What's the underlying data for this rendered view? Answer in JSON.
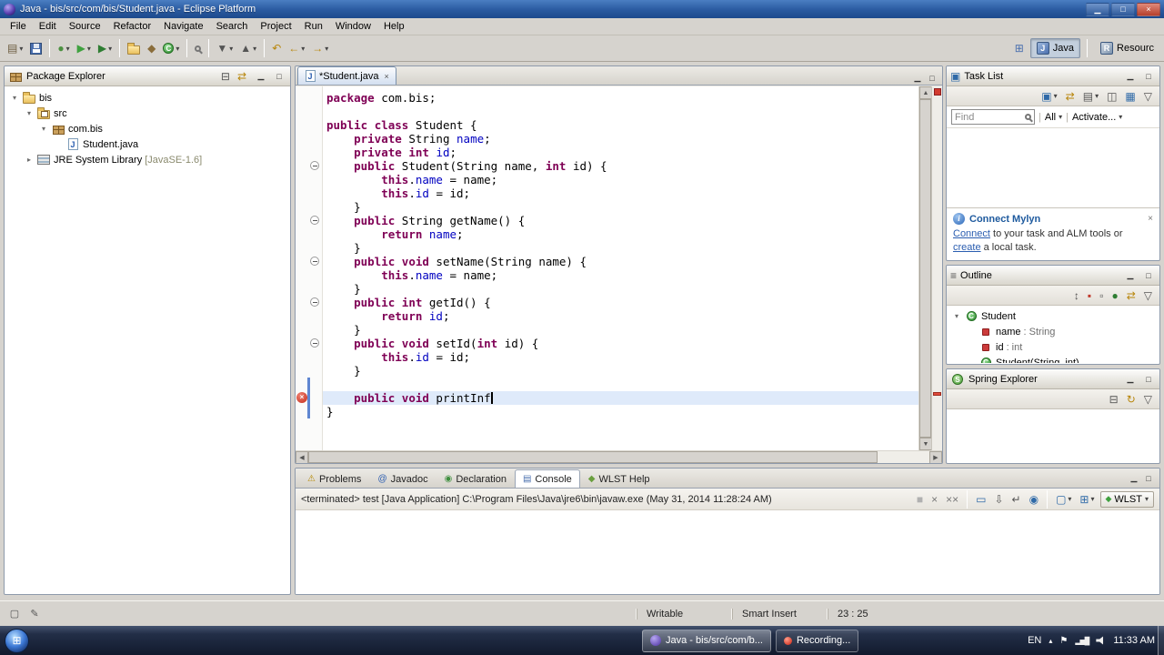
{
  "window": {
    "title": "Java - bis/src/com/bis/Student.java - Eclipse Platform"
  },
  "icons": {
    "minimize": "▁",
    "maximize": "□",
    "close": "×",
    "dropdown": "▾",
    "collapsed": "▸",
    "expanded": "▾",
    "up_scroll": "▲",
    "down_scroll": "▼",
    "left_scroll": "◀",
    "right_scroll": "▶",
    "start_orb": "⊞",
    "tray_arrow": "▴",
    "tray_flag": "⚑",
    "tray_net": "▂▅█",
    "find_magnifier": "magnifier"
  },
  "menubar": {
    "items": [
      "File",
      "Edit",
      "Source",
      "Refactor",
      "Navigate",
      "Search",
      "Project",
      "Run",
      "Window",
      "Help"
    ]
  },
  "toolbar": {
    "buttons": [
      {
        "name": "new-wizard-button",
        "glyph": "▤",
        "color": "#6b5b3e",
        "dropdown": true
      },
      {
        "name": "save-button",
        "css": "floppy"
      },
      {
        "sep": true
      },
      {
        "name": "debug-button",
        "glyph": "●",
        "color": "#4c9141",
        "dropdown": true
      },
      {
        "name": "run-button",
        "glyph": "▶",
        "color": "#3fa13f",
        "dropdown": true
      },
      {
        "name": "external-tools-run-button",
        "glyph": "▶",
        "color": "#2e7d32",
        "dropdown": true
      },
      {
        "sep": true
      },
      {
        "name": "new-java-project-button",
        "css": "folder"
      },
      {
        "name": "new-java-package-button",
        "glyph": "◆",
        "color": "#8a6d3b"
      },
      {
        "name": "new-java-class-button",
        "css": "class",
        "dropdown": true
      },
      {
        "sep": true
      },
      {
        "name": "search-button",
        "css": "magnifier"
      },
      {
        "sep": true
      },
      {
        "name": "next-annotation-button",
        "glyph": "▼",
        "color": "#555",
        "dropdown": true
      },
      {
        "name": "previous-annotation-button",
        "glyph": "▲",
        "color": "#555",
        "dropdown": true
      },
      {
        "sep": true
      },
      {
        "name": "last-edit-location-button",
        "glyph": "↶",
        "color": "#b8860b"
      },
      {
        "name": "back-button",
        "glyph": "←",
        "color": "#b8860b",
        "dropdown": true
      },
      {
        "name": "forward-button",
        "glyph": "→",
        "color": "#b8860b",
        "dropdown": true
      }
    ],
    "perspectives": {
      "active": "Java",
      "secondary": "Resourc"
    }
  },
  "package_explorer": {
    "title": "Package Explorer",
    "header_icons": [
      {
        "name": "collapse-all-button",
        "glyph": "⊟",
        "color": "#555"
      },
      {
        "name": "link-with-editor-button",
        "glyph": "⇄",
        "color": "#b8860b"
      }
    ],
    "tree": [
      {
        "label": "bis",
        "level": 0,
        "arrow": "expanded",
        "icon": "folder"
      },
      {
        "label": "src",
        "level": 1,
        "arrow": "expanded",
        "icon": "src"
      },
      {
        "label": "com.bis",
        "level": 2,
        "arrow": "expanded",
        "icon": "package"
      },
      {
        "label": "Student.java",
        "level": 3,
        "arrow": "none",
        "icon": "jfile"
      },
      {
        "label": "JRE System Library",
        "suffix": " [JavaSE-1.6]",
        "level": 1,
        "arrow": "collapsed",
        "icon": "lib"
      }
    ]
  },
  "editor": {
    "tab_label": "*Student.java",
    "cursor_line": 23,
    "error_line": 23,
    "fold_lines": [
      6,
      10,
      13,
      16,
      19
    ],
    "diff_lines": [
      22,
      23,
      24
    ],
    "overview_marks": [
      0.84
    ],
    "code": [
      [
        {
          "t": "k",
          "s": "package"
        },
        {
          "t": "p",
          "s": " com.bis;"
        }
      ],
      [],
      [
        {
          "t": "k",
          "s": "public"
        },
        {
          "t": "p",
          "s": " "
        },
        {
          "t": "k",
          "s": "class"
        },
        {
          "t": "p",
          "s": " Student {"
        }
      ],
      [
        {
          "t": "p",
          "s": "    "
        },
        {
          "t": "k",
          "s": "private"
        },
        {
          "t": "p",
          "s": " String "
        },
        {
          "t": "f",
          "s": "name"
        },
        {
          "t": "p",
          "s": ";"
        }
      ],
      [
        {
          "t": "p",
          "s": "    "
        },
        {
          "t": "k",
          "s": "private"
        },
        {
          "t": "p",
          "s": " "
        },
        {
          "t": "k",
          "s": "int"
        },
        {
          "t": "p",
          "s": " "
        },
        {
          "t": "f",
          "s": "id"
        },
        {
          "t": "p",
          "s": ";"
        }
      ],
      [
        {
          "t": "p",
          "s": "    "
        },
        {
          "t": "k",
          "s": "public"
        },
        {
          "t": "p",
          "s": " Student(String name, "
        },
        {
          "t": "k",
          "s": "int"
        },
        {
          "t": "p",
          "s": " id) {"
        }
      ],
      [
        {
          "t": "p",
          "s": "        "
        },
        {
          "t": "k",
          "s": "this"
        },
        {
          "t": "p",
          "s": "."
        },
        {
          "t": "f",
          "s": "name"
        },
        {
          "t": "p",
          "s": " = name;"
        }
      ],
      [
        {
          "t": "p",
          "s": "        "
        },
        {
          "t": "k",
          "s": "this"
        },
        {
          "t": "p",
          "s": "."
        },
        {
          "t": "f",
          "s": "id"
        },
        {
          "t": "p",
          "s": " = id;"
        }
      ],
      [
        {
          "t": "p",
          "s": "    }"
        }
      ],
      [
        {
          "t": "p",
          "s": "    "
        },
        {
          "t": "k",
          "s": "public"
        },
        {
          "t": "p",
          "s": " String getName() {"
        }
      ],
      [
        {
          "t": "p",
          "s": "        "
        },
        {
          "t": "k",
          "s": "return"
        },
        {
          "t": "p",
          "s": " "
        },
        {
          "t": "f",
          "s": "name"
        },
        {
          "t": "p",
          "s": ";"
        }
      ],
      [
        {
          "t": "p",
          "s": "    }"
        }
      ],
      [
        {
          "t": "p",
          "s": "    "
        },
        {
          "t": "k",
          "s": "public"
        },
        {
          "t": "p",
          "s": " "
        },
        {
          "t": "k",
          "s": "void"
        },
        {
          "t": "p",
          "s": " setName(String name) {"
        }
      ],
      [
        {
          "t": "p",
          "s": "        "
        },
        {
          "t": "k",
          "s": "this"
        },
        {
          "t": "p",
          "s": "."
        },
        {
          "t": "f",
          "s": "name"
        },
        {
          "t": "p",
          "s": " = name;"
        }
      ],
      [
        {
          "t": "p",
          "s": "    }"
        }
      ],
      [
        {
          "t": "p",
          "s": "    "
        },
        {
          "t": "k",
          "s": "public"
        },
        {
          "t": "p",
          "s": " "
        },
        {
          "t": "k",
          "s": "int"
        },
        {
          "t": "p",
          "s": " getId() {"
        }
      ],
      [
        {
          "t": "p",
          "s": "        "
        },
        {
          "t": "k",
          "s": "return"
        },
        {
          "t": "p",
          "s": " "
        },
        {
          "t": "f",
          "s": "id"
        },
        {
          "t": "p",
          "s": ";"
        }
      ],
      [
        {
          "t": "p",
          "s": "    }"
        }
      ],
      [
        {
          "t": "p",
          "s": "    "
        },
        {
          "t": "k",
          "s": "public"
        },
        {
          "t": "p",
          "s": " "
        },
        {
          "t": "k",
          "s": "void"
        },
        {
          "t": "p",
          "s": " setId("
        },
        {
          "t": "k",
          "s": "int"
        },
        {
          "t": "p",
          "s": " id) {"
        }
      ],
      [
        {
          "t": "p",
          "s": "        "
        },
        {
          "t": "k",
          "s": "this"
        },
        {
          "t": "p",
          "s": "."
        },
        {
          "t": "f",
          "s": "id"
        },
        {
          "t": "p",
          "s": " = id;"
        }
      ],
      [
        {
          "t": "p",
          "s": "    }"
        }
      ],
      [],
      [
        {
          "t": "p",
          "s": "    "
        },
        {
          "t": "k",
          "s": "public"
        },
        {
          "t": "p",
          "s": " "
        },
        {
          "t": "k",
          "s": "void"
        },
        {
          "t": "p",
          "s": " printInf"
        }
      ],
      [
        {
          "t": "p",
          "s": "}"
        }
      ]
    ]
  },
  "task_list": {
    "title": "Task List",
    "find_text": "Find",
    "all_label": "All",
    "activate_label": "Activate...",
    "toolbar_icons": [
      {
        "name": "new-task-button",
        "glyph": "▣",
        "color": "#2f6aa8",
        "dropdown": true
      },
      {
        "name": "synchronize-button",
        "glyph": "⇄",
        "color": "#b8860b"
      },
      {
        "name": "categorized-presentation-button",
        "glyph": "▤",
        "color": "#555",
        "dropdown": true
      },
      {
        "name": "hide-completed-button",
        "glyph": "◫",
        "color": "#555"
      },
      {
        "name": "focus-workweek-button",
        "glyph": "▦",
        "color": "#2f6aa8"
      },
      {
        "name": "view-menu-button",
        "glyph": "▽",
        "color": "#555"
      }
    ],
    "mylyn": {
      "title": "Connect Mylyn",
      "link1": "Connect",
      "mid": " to your task and ALM tools or ",
      "link2": "create",
      "tail": " a local task."
    }
  },
  "outline": {
    "title": "Outline",
    "toolbar_icons": [
      {
        "name": "sort-button",
        "glyph": "↕",
        "color": "#555"
      },
      {
        "name": "hide-fields-button",
        "glyph": "▪",
        "color": "#c0392b"
      },
      {
        "name": "hide-static-members-button",
        "glyph": "▫",
        "color": "#555"
      },
      {
        "name": "hide-non-public-members-button",
        "glyph": "●",
        "color": "#2e7d32"
      },
      {
        "name": "link-with-editor-button",
        "glyph": "⇄",
        "color": "#b8860b"
      },
      {
        "name": "view-menu-button",
        "glyph": "▽",
        "color": "#555"
      }
    ],
    "items": [
      {
        "label": "Student",
        "type": "",
        "level": 0,
        "arrow": "expanded",
        "icon": "class"
      },
      {
        "label": "name",
        "type": " : String",
        "level": 1,
        "arrow": "none",
        "icon": "field"
      },
      {
        "label": "id",
        "type": " : int",
        "level": 1,
        "arrow": "none",
        "icon": "field"
      },
      {
        "label": "Student(String, int)",
        "type": "",
        "level": 1,
        "arrow": "none",
        "icon": "class"
      }
    ]
  },
  "spring": {
    "title": "Spring Explorer",
    "toolbar_icons": [
      {
        "name": "collapse-all-button",
        "glyph": "⊟",
        "color": "#555"
      },
      {
        "name": "refresh-button",
        "glyph": "↻",
        "color": "#b8860b"
      },
      {
        "name": "view-menu-button",
        "glyph": "▽",
        "color": "#555"
      }
    ]
  },
  "bottom": {
    "tabs": [
      {
        "label": "Problems",
        "glyph": "⚠",
        "color": "#b58900",
        "active": false
      },
      {
        "label": "Javadoc",
        "glyph": "@",
        "color": "#2a5db0",
        "active": false
      },
      {
        "label": "Declaration",
        "glyph": "◉",
        "color": "#3f8f3f",
        "active": false
      },
      {
        "label": "Console",
        "glyph": "▤",
        "color": "#4a6fae",
        "active": true
      },
      {
        "label": "WLST Help",
        "glyph": "◆",
        "color": "#6a9f3e",
        "active": false
      }
    ],
    "console_line": "<terminated> test [Java Application] C:\\Program Files\\Java\\jre6\\bin\\javaw.exe (May 31, 2014 11:28:24 AM)",
    "toolbar_icons": [
      {
        "name": "terminate-button",
        "glyph": "■",
        "color": "#b0b0b0"
      },
      {
        "name": "remove-launch-button",
        "glyph": "×",
        "color": "#777"
      },
      {
        "name": "remove-all-launches-button",
        "glyph": "××",
        "color": "#777"
      },
      {
        "sep": true
      },
      {
        "name": "clear-console-button",
        "glyph": "▭",
        "color": "#2f6aa8"
      },
      {
        "name": "scroll-lock-button",
        "glyph": "⇩",
        "color": "#555"
      },
      {
        "name": "word-wrap-button",
        "glyph": "↵",
        "color": "#555"
      },
      {
        "name": "pin-console-button",
        "glyph": "◉",
        "color": "#2f6aa8"
      },
      {
        "sep": true
      },
      {
        "name": "display-selected-console-button",
        "glyph": "▢",
        "color": "#2f6aa8",
        "dropdown": true
      },
      {
        "name": "open-console-button",
        "glyph": "⊞",
        "color": "#2f6aa8",
        "dropdown": true
      }
    ],
    "wlst_label": "WLST"
  },
  "statusbar": {
    "writable": "Writable",
    "insert_mode": "Smart Insert",
    "position": "23 : 25"
  },
  "taskbar": {
    "apps": [
      {
        "name": "taskbar-app-eclipse",
        "label": "Java - bis/src/com/b...",
        "icon": "eclipse",
        "active": true
      },
      {
        "name": "taskbar-app-recording",
        "label": "Recording...",
        "icon": "record",
        "active": false
      }
    ],
    "lang": "EN",
    "time": "11:33 AM"
  }
}
